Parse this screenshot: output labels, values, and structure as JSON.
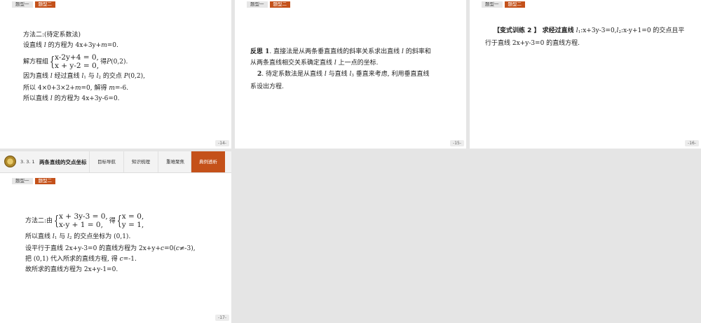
{
  "tabs": {
    "tab1": "题型一",
    "tab2": "题型二"
  },
  "slide14": {
    "page": "-14-",
    "l1": "方法二:(待定系数法)",
    "l2_a": "设直线 ",
    "l2_i": "l",
    "l2_b": " 的方程为 4x+3y+",
    "l2_m": "m",
    "l2_c": "=0.",
    "l3_a": "解方程组",
    "l3_eq1": "x-2y+4 = 0,",
    "l3_eq2": "x + y-2 = 0,",
    "l3_b": "得",
    "l3_p": "P",
    "l3_c": "(0,2).",
    "l4_a": "因为直线 ",
    "l4_i": "l",
    "l4_b": " 经过直线 ",
    "l4_l1": "l",
    "l4_s1": "1",
    "l4_c": " 与 ",
    "l4_l2": "l",
    "l4_s2": "2",
    "l4_d": " 的交点 ",
    "l4_p": "P",
    "l4_e": "(0,2),",
    "l5_a": "所以 4×0+3×2+",
    "l5_m": "m",
    "l5_b": "=0, 解得 ",
    "l5_m2": "m",
    "l5_c": "=-6.",
    "l6_a": "所以直线 ",
    "l6_i": "l",
    "l6_b": " 的方程为 4x+3y-6=0."
  },
  "slide15": {
    "page": "-15-",
    "l1_a": "反思 1",
    "l1_b": ". 直接法是从两条垂直直线的斜率关系求出直线 ",
    "l1_i": "l",
    "l1_c": " 的斜率和",
    "l2_a": "从两条直线相交关系确定直线 ",
    "l2_i": "l",
    "l2_b": " 上一点的坐标.",
    "l3_a": "2",
    "l3_b": ". 待定系数法是从直线 ",
    "l3_i": "l",
    "l3_c": " 与直线 ",
    "l3_l3": "l",
    "l3_s3": "3",
    "l3_d": " 垂直来考虑, 利用垂直直线",
    "l4": "系设出方程."
  },
  "slide16": {
    "page": "-16-",
    "l1_a": "【变式训练 2 】 求经过直线 ",
    "l1_l1": "l",
    "l1_s1": "1",
    "l1_b": ":x+3y-3=0,",
    "l1_l2": "l",
    "l1_s2": "2",
    "l1_c": ":x-y+1=0 的交点且平",
    "l2_a": "行于直线 2x+y-3=0 的直线方程."
  },
  "slide17": {
    "page": "-17-",
    "section_num": "3. 3. 1",
    "section_title": "两条直线的交点坐标",
    "nav": [
      "目标导航",
      "知识梳理",
      "重难聚焦",
      "典例透析"
    ],
    "l1_a": "方法二:由",
    "l1_eq1": "x + 3y-3 = 0,",
    "l1_eq2": "x-y + 1 = 0,",
    "l1_b": "得",
    "l1_r1": "x = 0,",
    "l1_r2": "y = 1,",
    "l2_a": "所以直线 ",
    "l2_l1": "l",
    "l2_s1": "1",
    "l2_b": " 与 ",
    "l2_l2": "l",
    "l2_s2": "2",
    "l2_c": " 的交点坐标为 (0,1).",
    "l3_a": "设平行于直线 2x+y-3=0 的直线方程为 2x+y+",
    "l3_c": "c",
    "l3_b": "=0(",
    "l3_c2": "c",
    "l3_d": "≠-3),",
    "l4_a": "把 (0,1) 代入所求的直线方程, 得 ",
    "l4_c": "c",
    "l4_b": "=-1.",
    "l5": "故所求的直线方程为 2x+y-1=0."
  }
}
